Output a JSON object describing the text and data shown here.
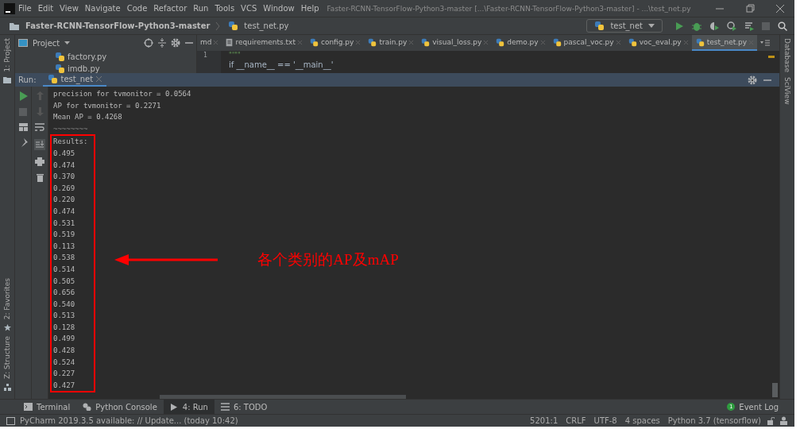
{
  "window": {
    "title": "Faster-RCNN-TensorFlow-Python3-master [...\\Faster-RCNN-TensorFlow-Python3-master] - ...\\test_net.py",
    "menu": [
      "File",
      "Edit",
      "View",
      "Navigate",
      "Code",
      "Refactor",
      "Run",
      "Tools",
      "VCS",
      "Window",
      "Help"
    ]
  },
  "breadcrumb": [
    {
      "label": "Faster-RCNN-TensorFlow-Python3-master",
      "kind": "folder"
    },
    {
      "label": "test_net.py",
      "kind": "python"
    }
  ],
  "run_config": "test_net",
  "left_stripe": [
    {
      "label": "1: Project",
      "kind": "top"
    },
    {
      "label": "2: Favorites",
      "kind": "bottom"
    },
    {
      "label": "Z: Structure",
      "kind": "bottom"
    }
  ],
  "right_stripe": [
    "Database",
    "SciView"
  ],
  "project_panel": {
    "title": "Project",
    "files": [
      "factory.py",
      "imdb.py"
    ]
  },
  "editor_tabs": [
    {
      "label": "md",
      "kind": "plain",
      "selected": false
    },
    {
      "label": "requirements.txt",
      "kind": "text",
      "selected": false
    },
    {
      "label": "config.py",
      "kind": "python",
      "selected": false
    },
    {
      "label": "train.py",
      "kind": "python",
      "selected": false
    },
    {
      "label": "visual_loss.py",
      "kind": "python",
      "selected": false
    },
    {
      "label": "demo.py",
      "kind": "python",
      "selected": false
    },
    {
      "label": "pascal_voc.py",
      "kind": "python",
      "selected": false
    },
    {
      "label": "voc_eval.py",
      "kind": "python",
      "selected": false
    },
    {
      "label": "test_net.py",
      "kind": "python",
      "selected": true
    }
  ],
  "editor_lines": [
    {
      "number": "1",
      "text": "\"\"\"\""
    },
    {
      "text": "if __name__ == '__main__'"
    }
  ],
  "run_panel": {
    "label": "Run:",
    "tab": "test_net"
  },
  "console": {
    "lines": [
      "precision for tvmonitor = 0.0564",
      "AP for tvmonitor = 0.2271",
      "Mean AP = 0.4268",
      "~~~~~~~~"
    ],
    "results_title": "Results:",
    "results": [
      "0.495",
      "0.474",
      "0.370",
      "0.269",
      "0.220",
      "0.474",
      "0.531",
      "0.519",
      "0.113",
      "0.538",
      "0.514",
      "0.505",
      "0.656",
      "0.540",
      "0.513",
      "0.128",
      "0.499",
      "0.428",
      "0.524",
      "0.227",
      "0.427"
    ]
  },
  "annotation": {
    "text": "各个类别的AP及mAP"
  },
  "tool_tabs": [
    {
      "label": "Terminal",
      "kind": "terminal",
      "selected": false
    },
    {
      "label": "Python Console",
      "kind": "python",
      "selected": false
    },
    {
      "label": "4: Run",
      "kind": "run",
      "selected": true
    },
    {
      "label": "6: TODO",
      "kind": "todo",
      "selected": false
    }
  ],
  "event_log": {
    "count": "1",
    "label": "Event Log"
  },
  "status_bar": {
    "message": "PyCharm 2019.3.5 available: // Update... (today 10:42)",
    "items": [
      "5201:1",
      "CRLF",
      "UTF-8",
      "4 spaces",
      "Python 3.7 (tensorflow)"
    ]
  }
}
